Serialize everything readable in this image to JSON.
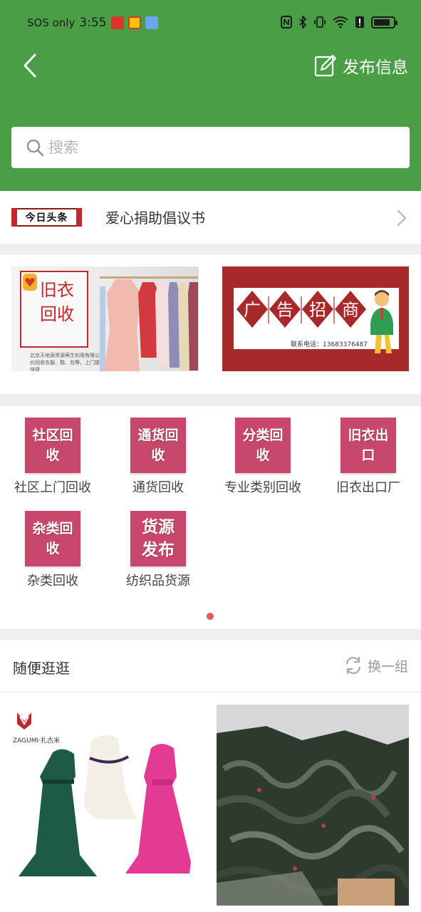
{
  "status_bar": {
    "carrier": "SOS only",
    "time": "3:55",
    "battery_level": 0.85
  },
  "header": {
    "back_icon": "chevron-left-icon",
    "publish_label": "发布信息",
    "publish_icon": "edit-icon",
    "search_placeholder": "搜索",
    "search_icon": "search-icon",
    "color": "#4a9e46"
  },
  "news": {
    "logo_text": "今日头条",
    "headline": "爱心捐助倡议书"
  },
  "banners": [
    {
      "title": "旧衣回收",
      "footer": "北京天地源资源再生利用有限公司 全国高价回收衣服、鞋、包等，上门提货，方便快捷"
    },
    {
      "title_chars": [
        "广",
        "告",
        "招",
        "商"
      ],
      "contact": "联系电话：13683376487"
    }
  ],
  "categories": [
    {
      "icon_text": "社区回收",
      "label": "社区上门回收"
    },
    {
      "icon_text": "通货回收",
      "label": "通货回收"
    },
    {
      "icon_text": "分类回收",
      "label": "专业类别回收"
    },
    {
      "icon_text": "旧衣出口",
      "label": "旧衣出口厂"
    },
    {
      "icon_text": "杂类回收",
      "label": "杂类回收"
    },
    {
      "icon_text": "货源发布",
      "label": "纺织品货源"
    }
  ],
  "pagination": {
    "current": 1,
    "total": 1
  },
  "browse": {
    "title": "随便逛逛",
    "refresh_label": "换一组",
    "refresh_icon": "refresh-icon",
    "card1_brand": "ZAGUMI·扎古米",
    "accent": "#c7486c"
  }
}
